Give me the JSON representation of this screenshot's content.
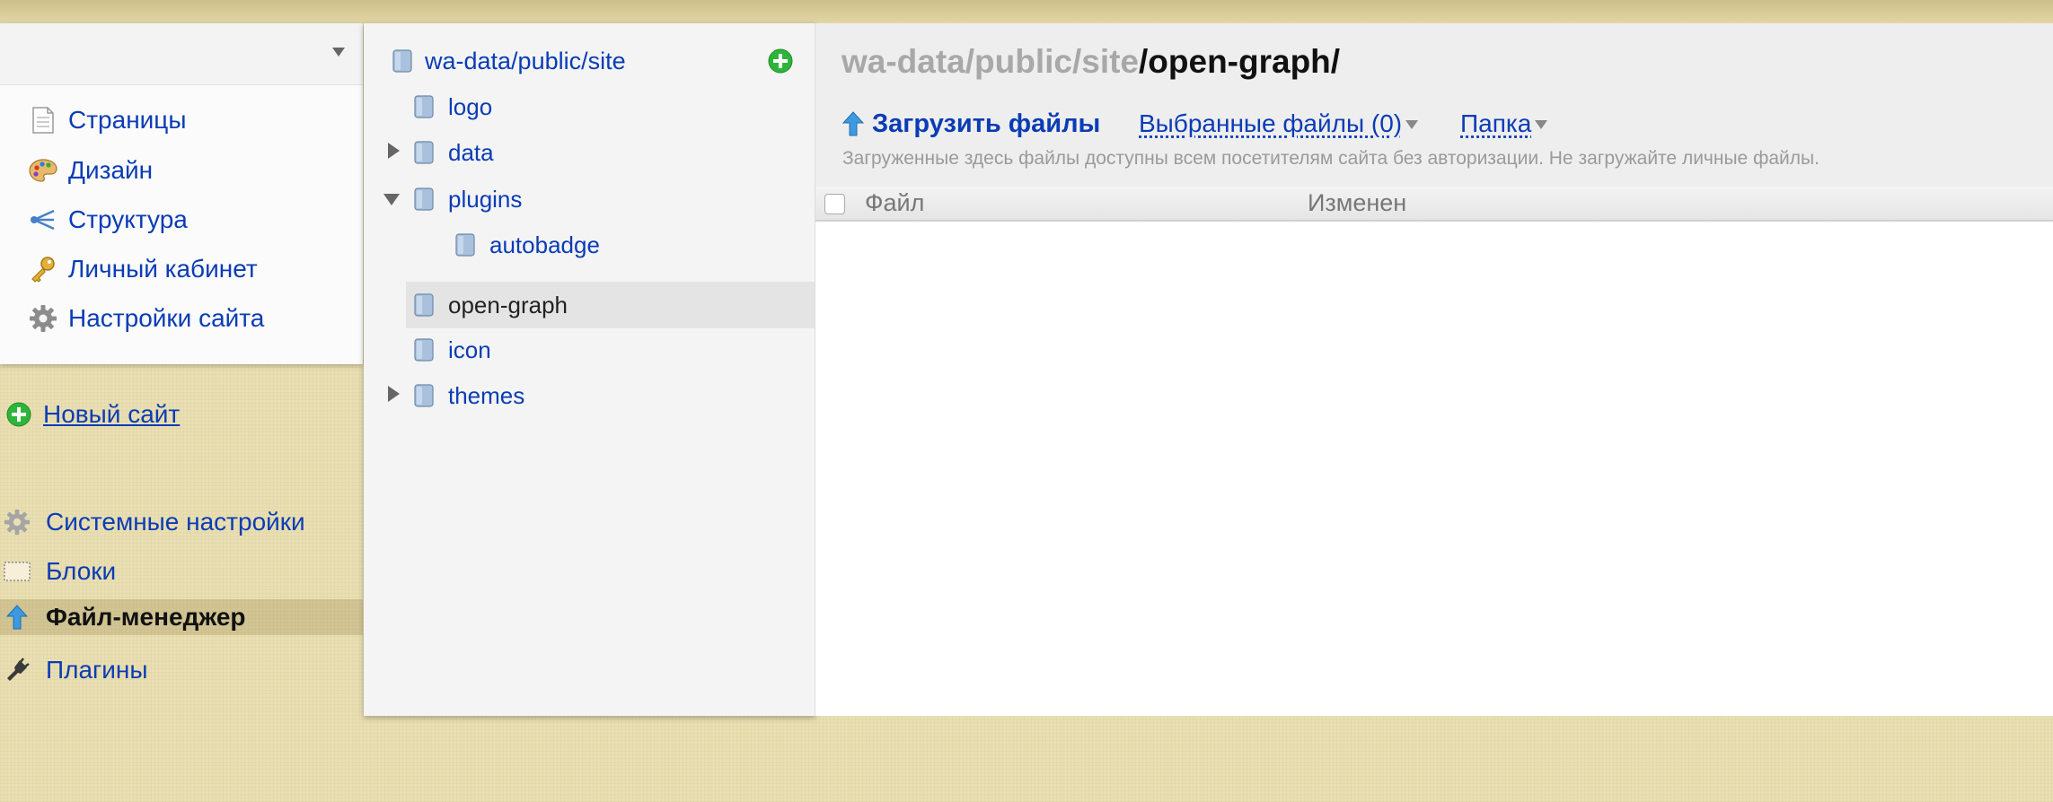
{
  "sidebar": {
    "items": [
      {
        "label": "Страницы",
        "icon": "page-icon"
      },
      {
        "label": "Дизайн",
        "icon": "palette-icon"
      },
      {
        "label": "Структура",
        "icon": "structure-icon"
      },
      {
        "label": "Личный кабинет",
        "icon": "key-icon"
      },
      {
        "label": "Настройки сайта",
        "icon": "gear-icon"
      }
    ],
    "new_site": "Новый сайт",
    "system": [
      {
        "label": "Системные настройки",
        "icon": "gear-icon"
      },
      {
        "label": "Блоки",
        "icon": "blocks-icon"
      },
      {
        "label": "Файл-менеджер",
        "icon": "upload-arrow-icon",
        "active": true
      },
      {
        "label": "Плагины",
        "icon": "plug-icon"
      }
    ]
  },
  "tree": {
    "root": "wa-data/public/site",
    "nodes": [
      {
        "label": "logo"
      },
      {
        "label": "data",
        "collapsed": true
      },
      {
        "label": "plugins",
        "expanded": true
      },
      {
        "label": "autobadge",
        "child_of": "plugins"
      },
      {
        "label": "open-graph",
        "selected": true
      },
      {
        "label": "icon"
      },
      {
        "label": "themes",
        "collapsed": true
      }
    ]
  },
  "main": {
    "path_base": "wa-data/public/site",
    "path_current": "/open-graph/",
    "upload_label": "Загрузить файлы",
    "selected_files_label": "Выбранные файлы (0)",
    "folder_label": "Папка",
    "hint": "Загруженные здесь файлы доступны всем посетителям сайта без авторизации. Не загружайте личные файлы.",
    "columns": {
      "file": "Файл",
      "modified": "Изменен"
    }
  },
  "colors": {
    "link": "#0a3cb5",
    "add_green": "#2db53a",
    "upload_arrow": "#3d9ae0"
  }
}
